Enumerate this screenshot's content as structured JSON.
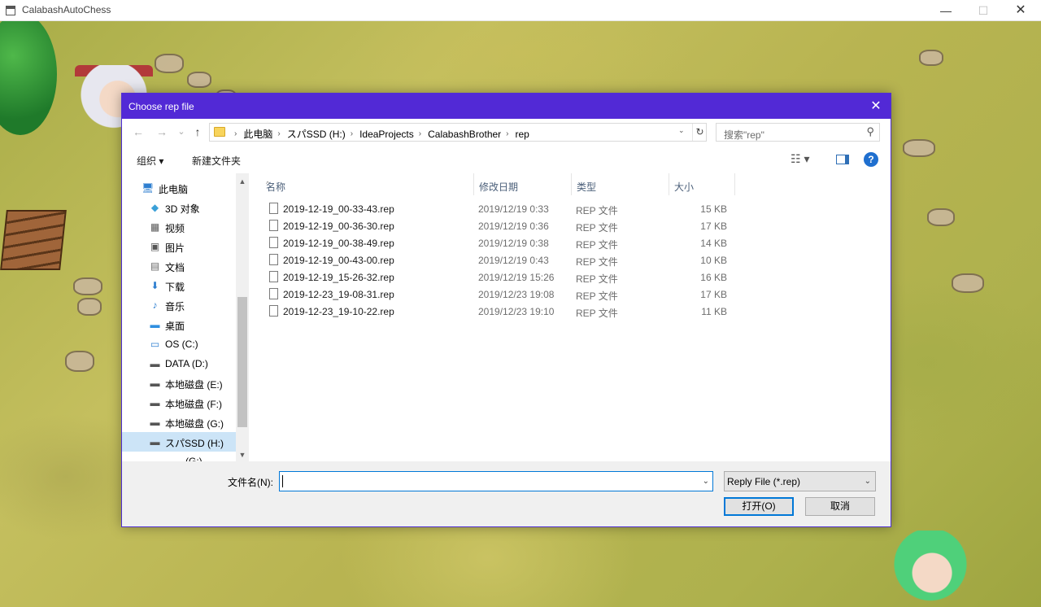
{
  "window": {
    "title": "CalabashAutoChess",
    "min_glyph": "—",
    "max_glyph": "☐",
    "close_glyph": "✕"
  },
  "dialog": {
    "title": "Choose rep file",
    "close_glyph": "✕",
    "nav": {
      "back_glyph": "←",
      "forward_glyph": "→",
      "recent_glyph": "⌄",
      "up_glyph": "↑"
    },
    "breadcrumb": [
      "此电脑",
      "スパSSD (H:)",
      "IdeaProjects",
      "CalabashBrother",
      "rep"
    ],
    "breadcrumb_sep": "›",
    "search_placeholder": "搜索\"rep\"",
    "toolbar": {
      "organize": "组织 ▾",
      "new_folder": "新建文件夹",
      "view_glyph": "☷ ▾",
      "help_glyph": "?"
    },
    "sidebar": {
      "items": [
        {
          "label": "此电脑",
          "icon": "computer-icon",
          "glyph": "🖥",
          "color": "#2f7fd0",
          "indent": 0,
          "selected": false
        },
        {
          "label": "3D 对象",
          "icon": "cube-icon",
          "glyph": "◆",
          "color": "#3aa0d8",
          "indent": 1,
          "selected": false
        },
        {
          "label": "视频",
          "icon": "video-icon",
          "glyph": "▦",
          "color": "#555555",
          "indent": 1,
          "selected": false
        },
        {
          "label": "图片",
          "icon": "picture-icon",
          "glyph": "▣",
          "color": "#555555",
          "indent": 1,
          "selected": false
        },
        {
          "label": "文档",
          "icon": "document-icon",
          "glyph": "▤",
          "color": "#666666",
          "indent": 1,
          "selected": false
        },
        {
          "label": "下载",
          "icon": "download-icon",
          "glyph": "⬇",
          "color": "#2f7fd0",
          "indent": 1,
          "selected": false
        },
        {
          "label": "音乐",
          "icon": "music-icon",
          "glyph": "♪",
          "color": "#2f7fd0",
          "indent": 1,
          "selected": false
        },
        {
          "label": "桌面",
          "icon": "desktop-icon",
          "glyph": "▬",
          "color": "#2f8fe0",
          "indent": 1,
          "selected": false
        },
        {
          "label": "OS (C:)",
          "icon": "system-drive-icon",
          "glyph": "▭",
          "color": "#2f7fd0",
          "indent": 1,
          "selected": false
        },
        {
          "label": "DATA (D:)",
          "icon": "drive-icon",
          "glyph": "▬",
          "color": "#555555",
          "indent": 1,
          "selected": false
        },
        {
          "label": "本地磁盘 (E:)",
          "icon": "drive-icon",
          "glyph": "▬",
          "color": "#555555",
          "indent": 1,
          "selected": false
        },
        {
          "label": "本地磁盘 (F:)",
          "icon": "drive-icon",
          "glyph": "▬",
          "color": "#555555",
          "indent": 1,
          "selected": false
        },
        {
          "label": "本地磁盘 (G:)",
          "icon": "drive-icon",
          "glyph": "▬",
          "color": "#555555",
          "indent": 1,
          "selected": false
        },
        {
          "label": "スパSSD (H:)",
          "icon": "drive-icon",
          "glyph": "▬",
          "color": "#555555",
          "indent": 1,
          "selected": true
        },
        {
          "label": "(G:)",
          "icon": "drive-icon",
          "glyph": "",
          "color": "#555555",
          "indent": 2,
          "selected": false
        }
      ],
      "scroll_up_glyph": "▲",
      "scroll_down_glyph": "▼"
    },
    "columns": {
      "name": "名称",
      "modified": "修改日期",
      "type": "类型",
      "size": "大小",
      "sort_glyph": "^"
    },
    "files": [
      {
        "name": "2019-12-19_00-33-43.rep",
        "modified": "2019/12/19 0:33",
        "type": "REP 文件",
        "size": "15 KB"
      },
      {
        "name": "2019-12-19_00-36-30.rep",
        "modified": "2019/12/19 0:36",
        "type": "REP 文件",
        "size": "17 KB"
      },
      {
        "name": "2019-12-19_00-38-49.rep",
        "modified": "2019/12/19 0:38",
        "type": "REP 文件",
        "size": "14 KB"
      },
      {
        "name": "2019-12-19_00-43-00.rep",
        "modified": "2019/12/19 0:43",
        "type": "REP 文件",
        "size": "10 KB"
      },
      {
        "name": "2019-12-19_15-26-32.rep",
        "modified": "2019/12/19 15:26",
        "type": "REP 文件",
        "size": "16 KB"
      },
      {
        "name": "2019-12-23_19-08-31.rep",
        "modified": "2019/12/23 19:08",
        "type": "REP 文件",
        "size": "17 KB"
      },
      {
        "name": "2019-12-23_19-10-22.rep",
        "modified": "2019/12/23 19:10",
        "type": "REP 文件",
        "size": "11 KB"
      }
    ],
    "filename_label": "文件名(N):",
    "filename_value": "",
    "filter_value": "Reply File (*.rep)",
    "dropdown_glyph": "⌄",
    "open_button": "打开(O)",
    "cancel_button": "取消"
  },
  "colors": {
    "dialog_title_bg": "#5229d6",
    "selection": "#cce4f7",
    "accent": "#0078d7"
  }
}
